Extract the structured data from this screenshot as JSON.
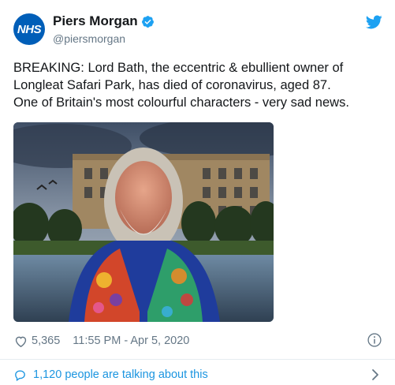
{
  "colors": {
    "text": "#14171a",
    "muted": "#657786",
    "link": "#1b95e0",
    "verified": "#1da1f2",
    "nhs_blue": "#005eb8"
  },
  "author": {
    "avatar_text": "NHS",
    "display_name": "Piers Morgan",
    "handle": "@piersmorgan",
    "verified_icon": "verified-badge-icon"
  },
  "platform_icon": "twitter-bird-icon",
  "tweet": {
    "text": "BREAKING: Lord Bath, the eccentric & ebullient owner of\nLongleat Safari Park, has died of coronavirus, aged 87.\nOne of Britain's most colourful characters - very sad news."
  },
  "meta": {
    "like_icon": "heart-icon",
    "like_count": "5,365",
    "timestamp": "11:55 PM - Apr 5, 2020",
    "info_icon": "info-icon"
  },
  "footer": {
    "icon": "speech-bubble-icon",
    "text": "1,120 people are talking about this",
    "chevron_icon": "chevron-right-icon"
  }
}
